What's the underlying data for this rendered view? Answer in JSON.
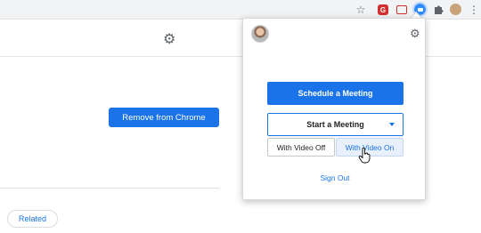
{
  "toolbar": {
    "icons": [
      "star-icon",
      "ext-red-icon",
      "ext-cast-icon",
      "zoom-extension-icon",
      "puzzle-icon",
      "profile-avatar-icon",
      "kebab-menu-icon"
    ],
    "ext_red_label": "G"
  },
  "page": {
    "remove_button": "Remove from Chrome",
    "related_button": "Related"
  },
  "popup": {
    "schedule_button": "Schedule a Meeting",
    "start_button": "Start a Meeting",
    "video_off": "With Video Off",
    "video_on": "With Video On",
    "sign_out": "Sign Out"
  },
  "colors": {
    "primary": "#1a73e8",
    "zoom_blue": "#2d8cff",
    "toolbar_bg": "#f1f3f4"
  }
}
